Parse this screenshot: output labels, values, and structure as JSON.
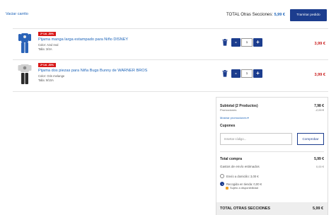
{
  "header": {
    "clear_cart": "Vaciar carrito",
    "total_label": "TOTAL Otras Secciones:",
    "total_value": "5,99 €",
    "process_button": "Tramitar pedido"
  },
  "items": [
    {
      "badge": "2ª Ud. -50%",
      "name": "Pijama manga larga estampado para Niño DISNEY",
      "color": "Color: Azul real",
      "size": "Talla: 3/4A",
      "quantity": "1",
      "price": "3,99 €",
      "thumb_color": "#2a63b8"
    },
    {
      "badge": "2ª Ud. -50%",
      "name": "Pijama dos piezas para Niña Bugs Bunny de WARNER BROS",
      "color": "Color: Gris melange",
      "size": "Talla: 9/10A",
      "quantity": "1",
      "price": "3,99 €",
      "thumb_color": "#2b2b2b"
    }
  ],
  "summary": {
    "subtotal_label": "Subtotal (2 Productos)",
    "subtotal_value": "7,98 €",
    "promotions_label": "Promociones",
    "promotions_value": "-2,00 €",
    "show_promotions": "Mostrar promociones  ▾",
    "coupons_label": "Cupones",
    "coupon_placeholder": "Insertar código...",
    "apply_button": "Comprobar",
    "total_label": "Total compra",
    "total_value": "5,99 €",
    "shipping_label": "Gastos de envío estimados",
    "shipping_value": "0,00 €",
    "option_home": "Envío a domicilio: 3,00 €",
    "option_store": "Recogida en tienda: 0,00 €",
    "availability": "Sujeto a disponibilidad",
    "grand_label": "TOTAL OTRAS SECCIONES",
    "grand_value": "5,99 €"
  },
  "colors": {
    "accent": "#1c3d8e",
    "link": "#1c63b8",
    "price": "#c81919",
    "badge": "#d81a1a"
  }
}
